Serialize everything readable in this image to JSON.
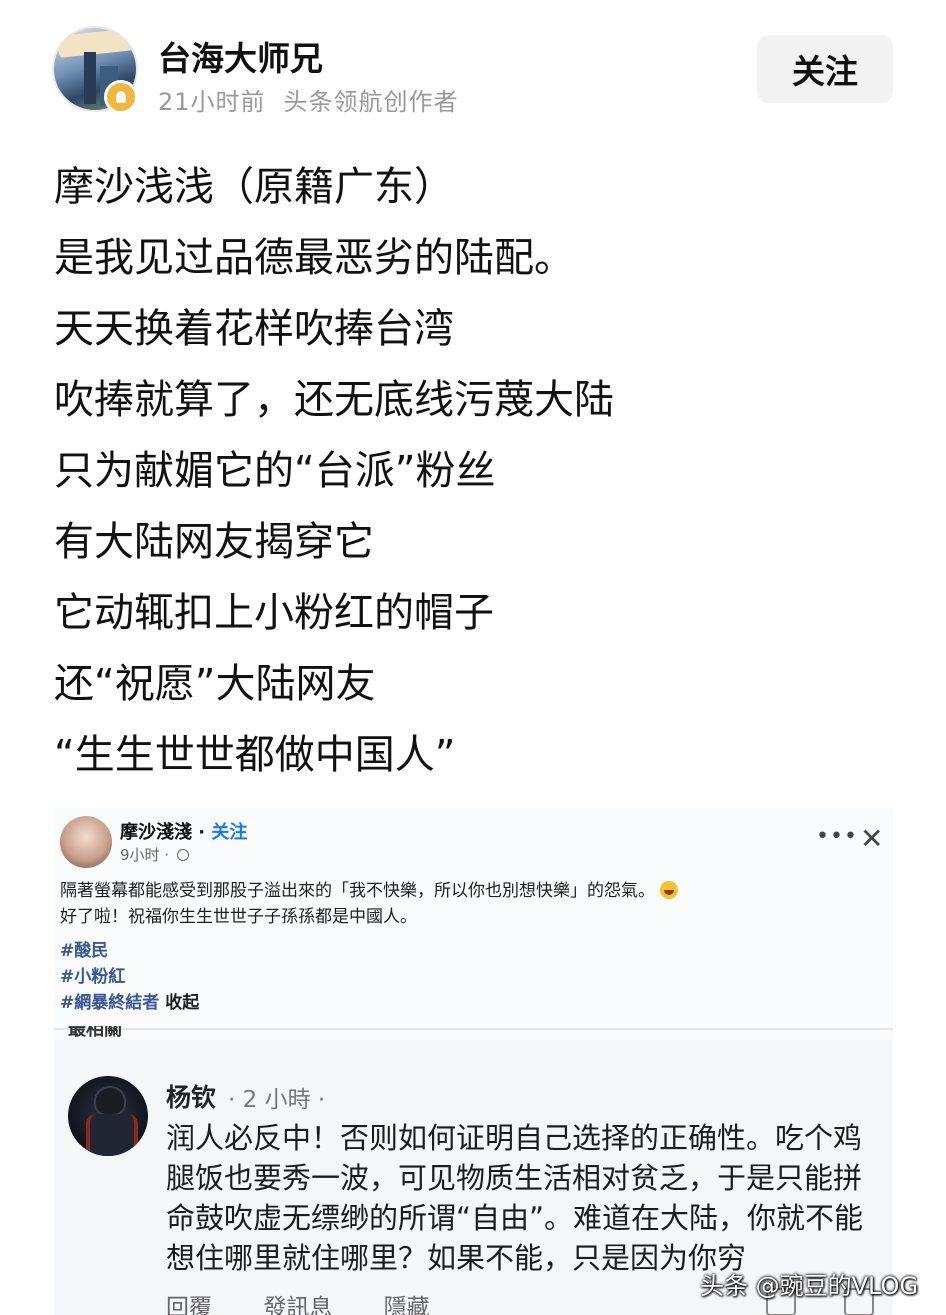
{
  "author": {
    "name": "台海大师兄",
    "time": "21小时前",
    "title": "头条领航创作者",
    "follow_label": "关注"
  },
  "post": {
    "lines": [
      "摩沙浅浅（原籍广东）",
      "是我见过品德最恶劣的陆配。",
      "天天换着花样吹捧台湾",
      "吹捧就算了，还无底线污蔑大陆",
      "只为献媚它的“台派”粉丝",
      "有大陆网友揭穿它",
      "它动辄扣上小粉红的帽子",
      "还“祝愿”大陆网友",
      "“生生世世都做中国人”"
    ]
  },
  "embedded_post": {
    "name": "摩沙淺淺",
    "separator": " · ",
    "follow_label": "关注",
    "time": "9小时 · ",
    "more_icon": "•••",
    "close_icon": "✕",
    "text_line1": "隔著螢幕都能感受到那股子溢出來的「我不快樂，所以你也別想快樂」的怨氣。",
    "text_line2": "好了啦！祝福你生生世世子子孫孫都是中國人。",
    "tags": [
      "#酸民",
      "#小粉紅",
      "#網暴終結者"
    ],
    "collapse_label": "收起",
    "cut_text": "最相關"
  },
  "comment": {
    "name": "杨钦",
    "time": "· 2 小時 ·",
    "text": "润人必反中！否则如何证明自己选择的正确性。吃个鸡腿饭也要秀一波，可见物质生活相对贫乏，于是只能拼命鼓吹虚无缥缈的所谓“自由”。难道在大陆，你就不能想住哪里就住哪里？如果不能，只是因为你穷",
    "actions": [
      "回覆",
      "發訊息",
      "隱藏"
    ]
  },
  "watermark": "头条 @豌豆的VLOG"
}
